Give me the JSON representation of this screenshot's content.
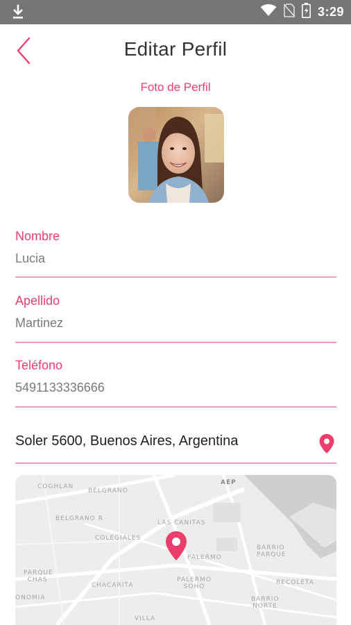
{
  "status_bar": {
    "time": "3:29",
    "icons": [
      "download-icon",
      "wifi-icon",
      "no-sim-icon",
      "battery-icon"
    ]
  },
  "header": {
    "title": "Editar Perfil",
    "back_icon": "chevron-left-icon"
  },
  "profile": {
    "photo_label": "Foto de Perfil"
  },
  "form": {
    "nombre": {
      "label": "Nombre",
      "value": "Lucia"
    },
    "apellido": {
      "label": "Apellido",
      "value": "Martinez"
    },
    "telefono": {
      "label": "Teléfono",
      "value": "5491133336666"
    },
    "address": {
      "value": "Soler 5600, Buenos Aires, Argentina",
      "icon": "location-pin-icon"
    }
  },
  "map": {
    "labels": {
      "coghlan": "COGHLAN",
      "belgrano": "BELGRANO",
      "belgrano_r": "BELGRANO R",
      "colegiales": "COLEGIALES",
      "las_canitas": "LAS CANITAS",
      "palermo": "PALERMO",
      "palermo_soho": "PALERMO SOHO",
      "parque_chas": "PARQUE CHAS",
      "chacarita": "CHACARITA",
      "villa": "VILLA",
      "recoleta": "RECOLETA",
      "barrio_parque": "BARRIO PARQUE",
      "barrio_norte": "BARRIO NORTE",
      "aep": "AEP",
      "ateneo": "ONOMIA"
    },
    "colors": {
      "background": "#ededed",
      "roads": "#ffffff",
      "water": "#c9c9c9",
      "marker": "#ec3e6b"
    }
  },
  "theme": {
    "accent": "#ec3e6b",
    "underline": "#f59cb4",
    "status_bar": "#767676"
  }
}
